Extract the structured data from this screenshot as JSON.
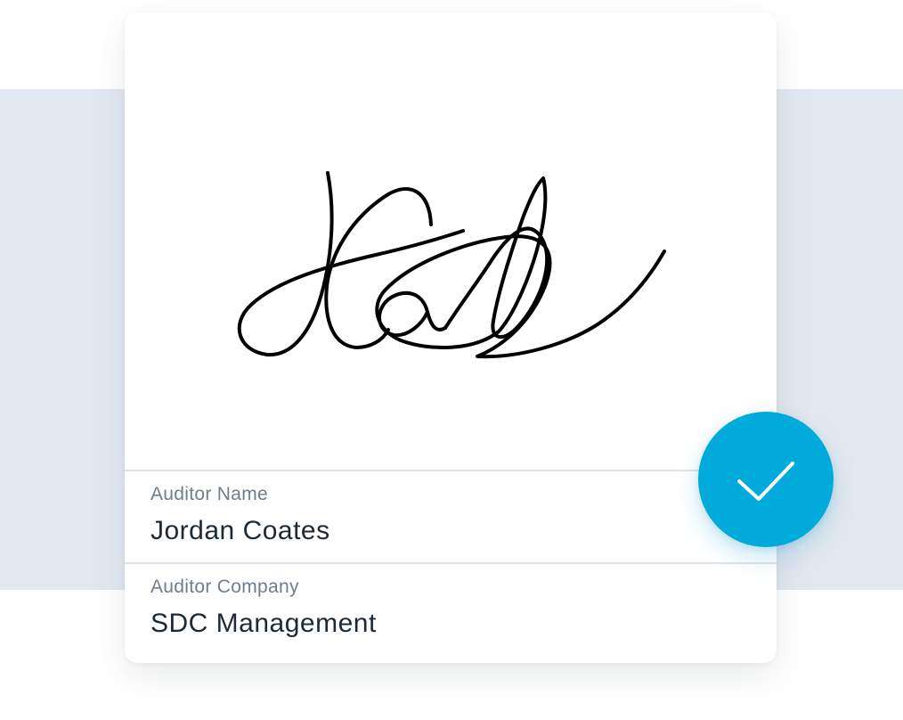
{
  "signature_pad": {
    "stroke_color": "#000000"
  },
  "fields": {
    "auditor_name": {
      "label": "Auditor Name",
      "value": "Jordan Coates"
    },
    "auditor_company": {
      "label": "Auditor Company",
      "value": "SDC Management"
    }
  },
  "confirm_button": {
    "icon": "checkmark-icon",
    "color": "#00aadb"
  }
}
